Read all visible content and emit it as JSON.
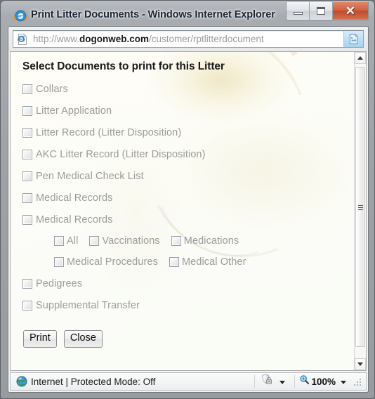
{
  "window": {
    "title": "Print Litter Documents - Windows Internet Explorer",
    "app_icon": "internet-explorer-icon",
    "controls": {
      "minimize": "minimize-icon",
      "maximize": "maximize-icon",
      "close": "✕"
    }
  },
  "address_bar": {
    "page_icon": "page-icon",
    "url_prefix": "http://www.",
    "url_domain": "dogonweb.com",
    "url_path": "/customer/rptlitterdocument",
    "compatibility_button": "compatibility-view-icon"
  },
  "page": {
    "title": "Select Documents to print for this Litter",
    "checkboxes": [
      {
        "label": "Collars",
        "checked": false
      },
      {
        "label": "Litter Application",
        "checked": false
      },
      {
        "label": "Litter Record (Litter Disposition)",
        "checked": false
      },
      {
        "label": "AKC Litter Record (Litter Disposition)",
        "checked": false
      },
      {
        "label": "Pen Medical Check List",
        "checked": false
      },
      {
        "label": "Medical Records",
        "checked": false
      },
      {
        "label": "Medical Records",
        "checked": false
      }
    ],
    "sub_checkbox_rows": [
      [
        {
          "label": "All",
          "checked": false
        },
        {
          "label": "Vaccinations",
          "checked": false
        },
        {
          "label": "Medications",
          "checked": false
        }
      ],
      [
        {
          "label": "Medical Procedures",
          "checked": false
        },
        {
          "label": "Medical Other",
          "checked": false
        }
      ]
    ],
    "trailing_checkboxes": [
      {
        "label": "Pedigrees",
        "checked": false
      },
      {
        "label": "Supplemental Transfer",
        "checked": false
      }
    ],
    "buttons": {
      "print": "Print",
      "close": "Close"
    }
  },
  "scrollbar": {
    "up_arrow": "scroll-up-icon",
    "down_arrow": "scroll-down-icon"
  },
  "status_bar": {
    "zone_icon": "globe-icon",
    "zone_text": "Internet | Protected Mode: Off",
    "protection_icon": "shield-lock-icon",
    "zoom_icon": "magnifier-icon",
    "zoom_level": "100%"
  },
  "colors": {
    "title_text": "#1c2433",
    "close_button": "#cf6243",
    "disabled_label": "#9b9b9b",
    "page_background": "#fffffc"
  }
}
